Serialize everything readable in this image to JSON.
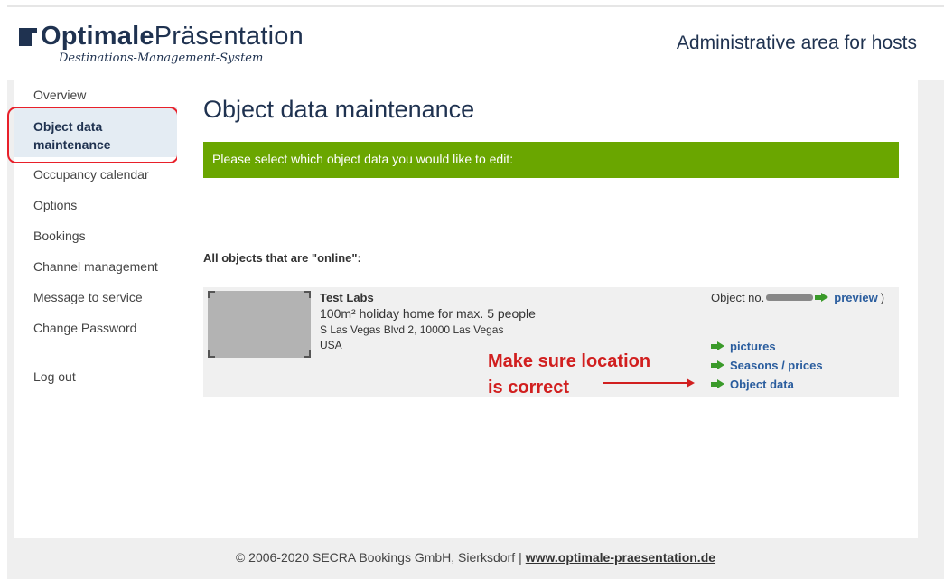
{
  "header": {
    "logo_bold": "Optimale",
    "logo_regular": "Präsentation",
    "logo_tagline": "Destinations-Management-System",
    "area_title": "Administrative area for hosts"
  },
  "sidebar": {
    "items": [
      {
        "label": "Overview"
      },
      {
        "label": "Object data maintenance",
        "active": true
      },
      {
        "label": "Occupancy calendar"
      },
      {
        "label": "Options"
      },
      {
        "label": "Bookings"
      },
      {
        "label": "Channel management"
      },
      {
        "label": "Message to service"
      },
      {
        "label": "Change Password"
      },
      {
        "label": "Log out"
      }
    ]
  },
  "main": {
    "title": "Object data maintenance",
    "banner": "Please select which object data you would like to edit:",
    "section_label": "All objects that are \"online\":",
    "object": {
      "name": "Test Labs",
      "description": "100m² holiday home for max. 5 people",
      "address": "S Las Vegas Blvd 2, 10000 Las Vegas",
      "country": "USA",
      "object_no_label": "Object no.",
      "preview_label": "preview",
      "preview_suffix": ")",
      "links": [
        {
          "label": "pictures",
          "icon": "green-arrow-right"
        },
        {
          "label": "Seasons / prices",
          "icon": "green-arrow-right"
        },
        {
          "label": "Object data",
          "icon": "green-arrow-right"
        }
      ]
    }
  },
  "annotation": {
    "line1": "Make sure location",
    "line2": "is correct",
    "color": "#d11f1f"
  },
  "footer": {
    "copyright": "© 2006-2020 SECRA Bookings GmbH, Sierksdorf",
    "separator": "|",
    "website": "www.optimale-praesentation.de"
  },
  "colors": {
    "brand_navy": "#1f3250",
    "banner_green": "#6aa600",
    "link_blue": "#2a5d9e",
    "active_nav_bg": "#e4ecf3",
    "highlight_red": "#e8202a"
  }
}
